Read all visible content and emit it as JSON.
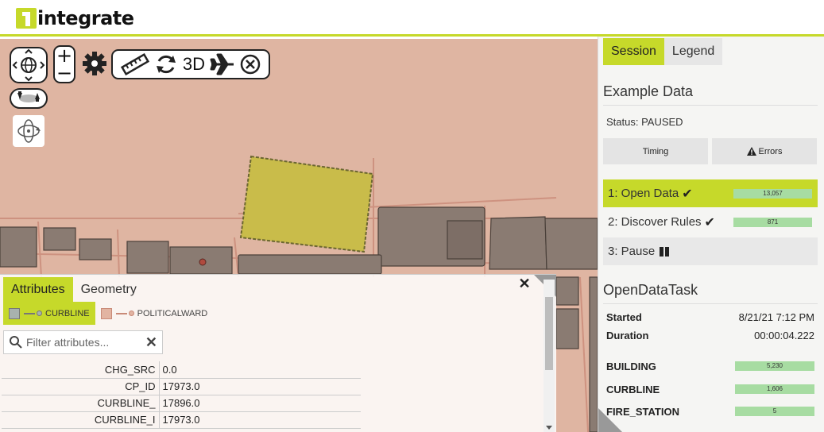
{
  "app": {
    "logo_text": "integrate"
  },
  "map_toolbar": {
    "label_3d": "3D"
  },
  "attributes": {
    "tabs": [
      {
        "label": "Attributes",
        "active": true
      },
      {
        "label": "Geometry",
        "active": false
      }
    ],
    "layers": [
      {
        "label": "CURBLINE",
        "swatch": "#a8b2ae",
        "active": true
      },
      {
        "label": "POLITICALWARD",
        "swatch": "#e2b4a2",
        "active": false
      }
    ],
    "filter_placeholder": "Filter attributes...",
    "rows": [
      {
        "key": "CHG_SRC",
        "value": "0.0"
      },
      {
        "key": "CP_ID",
        "value": "17973.0"
      },
      {
        "key": "CURBLINE_",
        "value": "17896.0"
      },
      {
        "key": "CURBLINE_I",
        "value": "17973.0"
      }
    ]
  },
  "session": {
    "tabs": [
      {
        "label": "Session",
        "active": true
      },
      {
        "label": "Legend",
        "active": false
      }
    ],
    "title": "Example Data",
    "status": "Status: PAUSED",
    "buttons": {
      "timing": "Timing",
      "errors": "Errors"
    },
    "steps": [
      {
        "label": "1: Open Data",
        "count": "13,057",
        "done": true
      },
      {
        "label": "2: Discover Rules",
        "count": "871",
        "done": true
      },
      {
        "label": "3: Pause",
        "count": "",
        "done": false
      }
    ],
    "task": {
      "title": "OpenDataTask",
      "started_label": "Started",
      "started_value": "8/21/21 7:12 PM",
      "duration_label": "Duration",
      "duration_value": "00:00:04.222",
      "counts": [
        {
          "name": "BUILDING",
          "count": "5,230"
        },
        {
          "name": "CURBLINE",
          "count": "1,606"
        },
        {
          "name": "FIRE_STATION",
          "count": "5"
        }
      ]
    }
  },
  "colors": {
    "accent": "#c6d92a",
    "map_bg": "#dfb5a2",
    "building": "#8a7b72",
    "highlight": "#c9bc4a",
    "count_bar": "#a7dca2"
  },
  "icons": [
    "compass-icon",
    "zoom-in-icon",
    "zoom-out-icon",
    "gear-icon",
    "ruler-icon",
    "refresh-icon",
    "airplane-icon",
    "close-circle-icon",
    "tilt-icon",
    "orbit-icon",
    "close-icon",
    "search-icon",
    "clear-icon",
    "checkmark-icon",
    "pause-icon",
    "warning-icon"
  ]
}
